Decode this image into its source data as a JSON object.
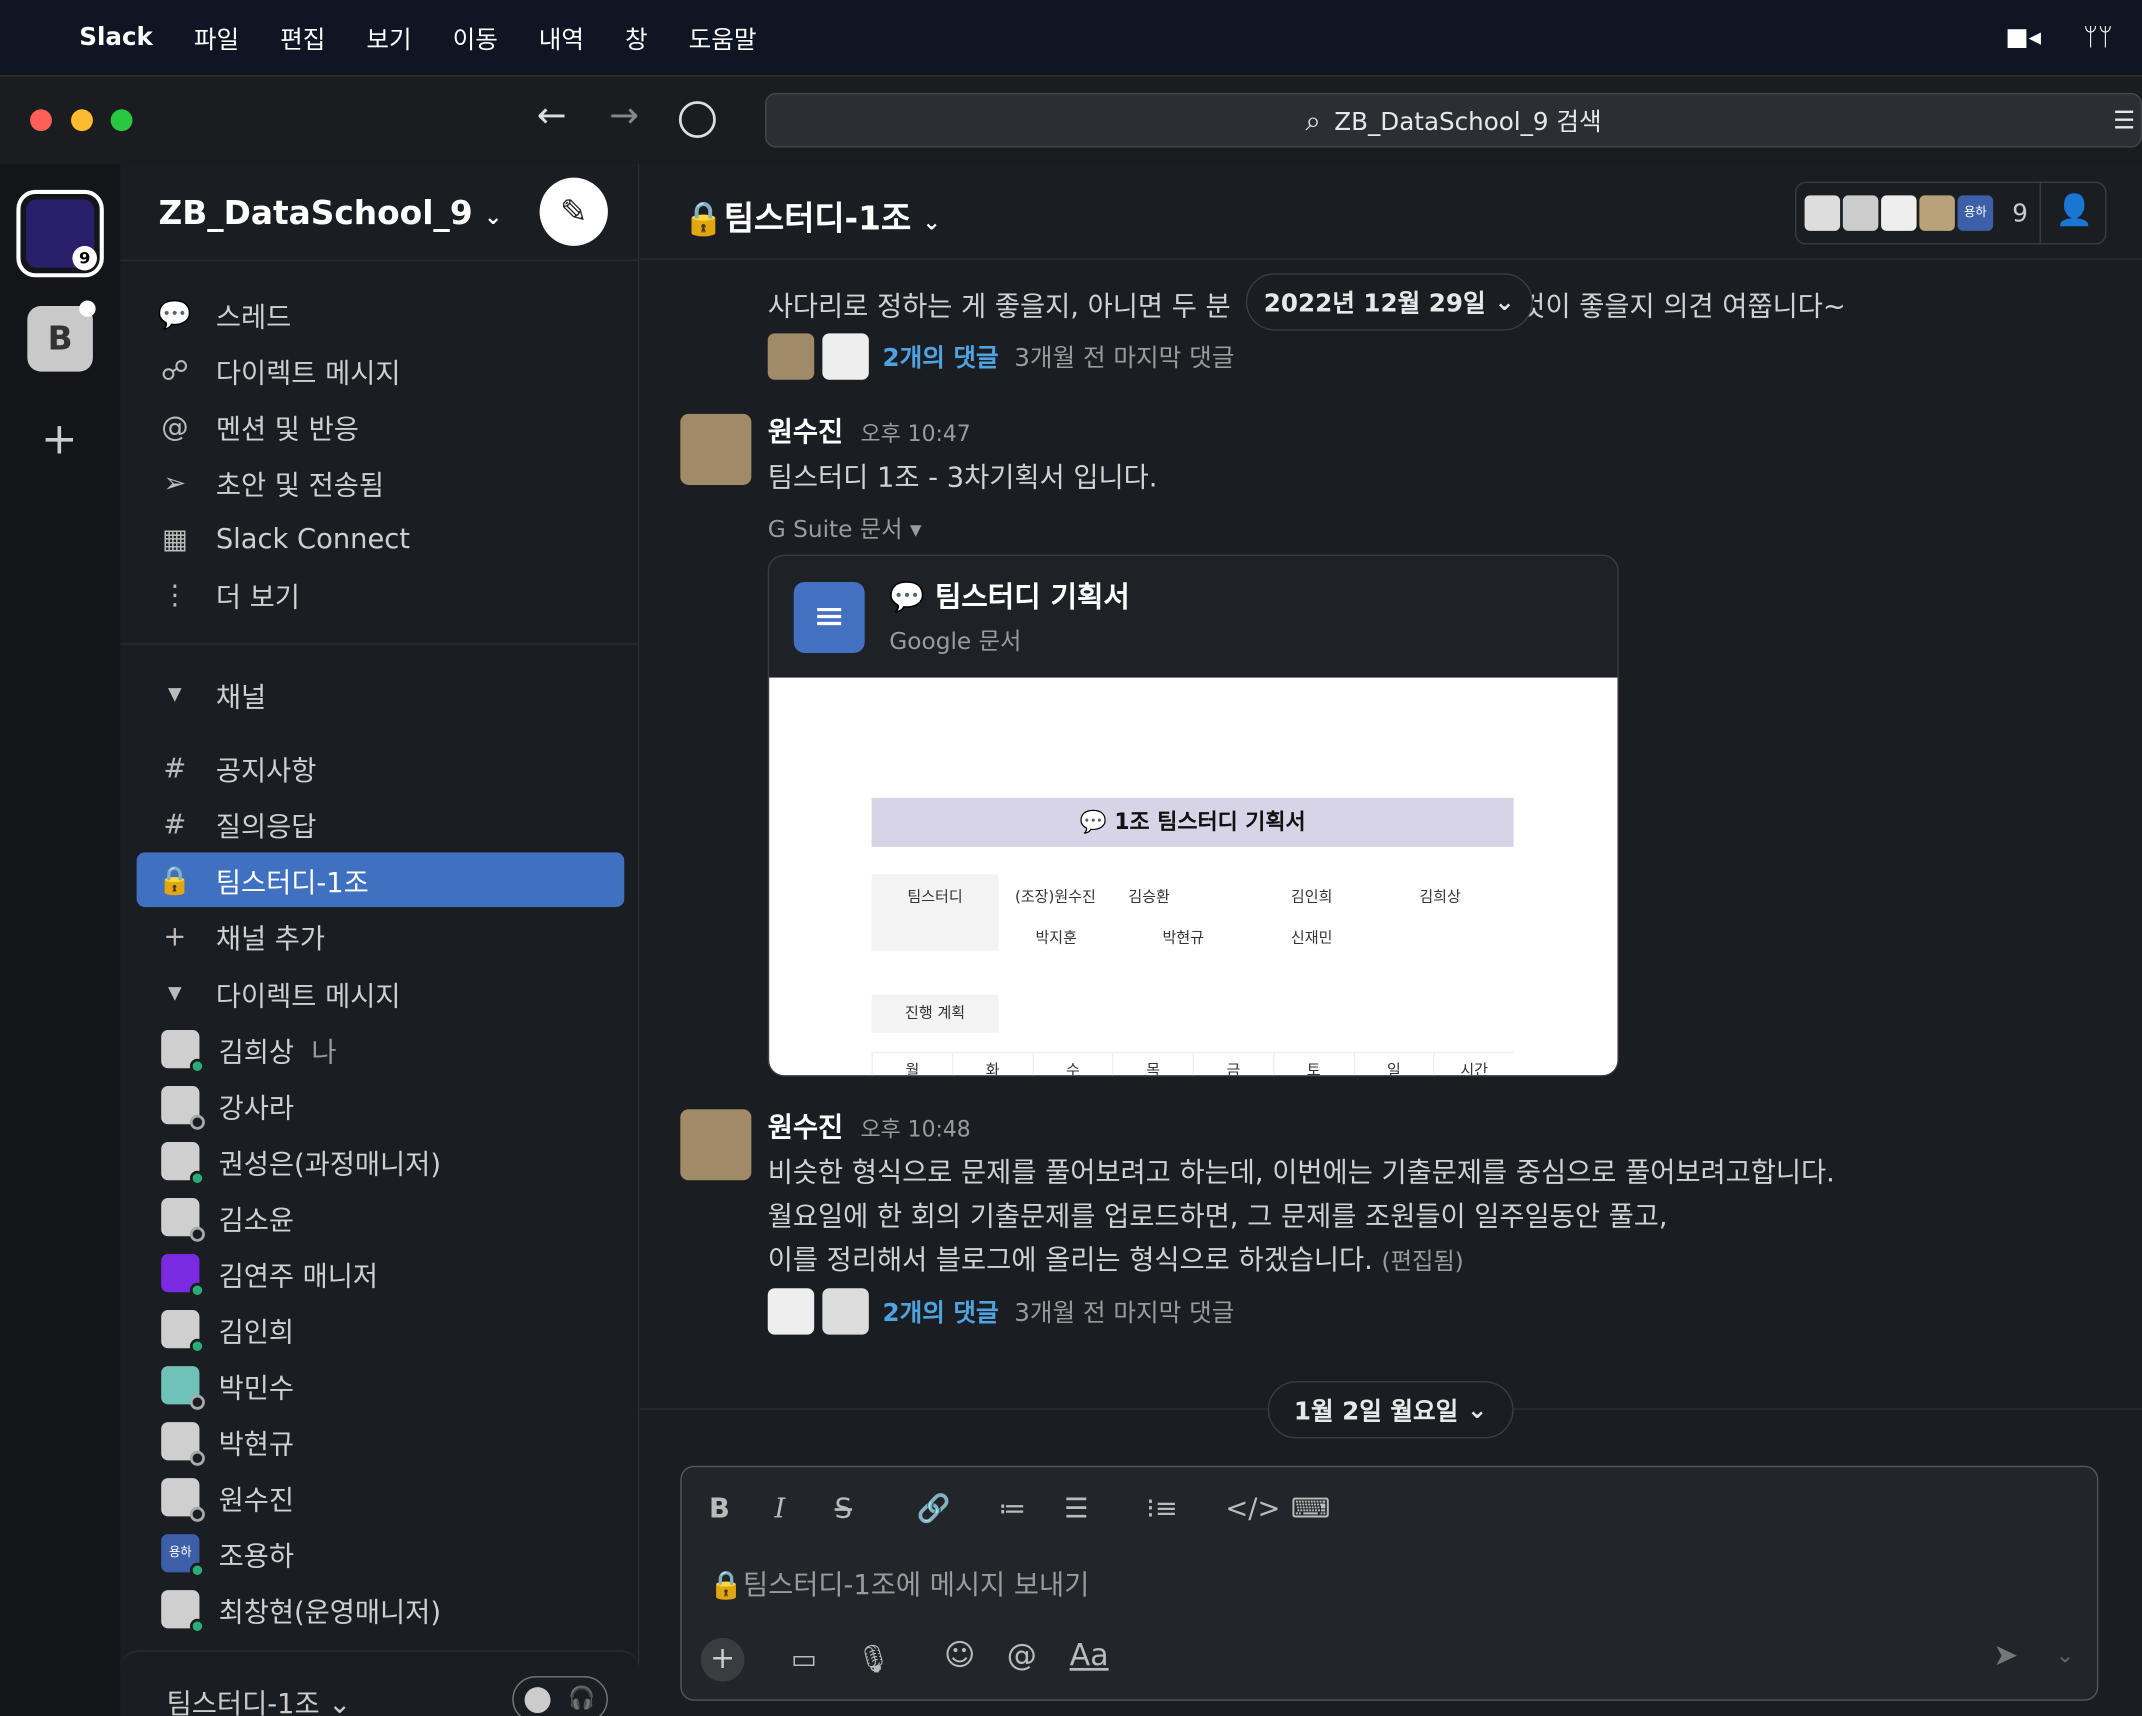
{
  "menubar": {
    "app": "Slack",
    "items": [
      "파일",
      "편집",
      "보기",
      "이동",
      "내역",
      "창",
      "도움말"
    ]
  },
  "titlebar": {
    "search": "ZB_DataSchool_9 검색"
  },
  "rail": {
    "workspace_badge": "9",
    "second_workspace": "B"
  },
  "sidebar": {
    "workspace": "ZB_DataSchool_9",
    "nav": [
      {
        "icon": "thread-icon",
        "glyph": "💬",
        "label": "스레드"
      },
      {
        "icon": "dm-icon",
        "glyph": "☍",
        "label": "다이렉트 메시지"
      },
      {
        "icon": "at-icon",
        "glyph": "@",
        "label": "멘션 및 반응"
      },
      {
        "icon": "send-icon",
        "glyph": "➢",
        "label": "초안 및 전송됨"
      },
      {
        "icon": "building-icon",
        "glyph": "▦",
        "label": "Slack Connect"
      },
      {
        "icon": "more-icon",
        "glyph": "⋮",
        "label": "더 보기"
      }
    ],
    "channels_header": "채널",
    "channels": [
      {
        "prefix": "#",
        "label": "공지사항"
      },
      {
        "prefix": "#",
        "label": "질의응답"
      },
      {
        "prefix": "🔒",
        "label": "팀스터디-1조",
        "selected": true
      },
      {
        "prefix": "+",
        "label": "채널 추가"
      }
    ],
    "dm_header": "다이렉트 메시지",
    "dms": [
      {
        "name": "김희상",
        "suffix": "나",
        "online": true
      },
      {
        "name": "강사라",
        "online": false
      },
      {
        "name": "권성은(과정매니저)",
        "online": true
      },
      {
        "name": "김소윤",
        "online": false
      },
      {
        "name": "김연주 매니저",
        "online": true,
        "color": "#7a2be2"
      },
      {
        "name": "김인희",
        "online": true
      },
      {
        "name": "박민수",
        "online": false,
        "color": "#6fc2b8"
      },
      {
        "name": "박현규",
        "online": false
      },
      {
        "name": "원수진",
        "online": false
      },
      {
        "name": "조용하",
        "online": true,
        "color": "#3d5fa8",
        "initials": "용하"
      },
      {
        "name": "최창현(운영매니저)",
        "online": true
      }
    ],
    "footer": "팀스터디-1조"
  },
  "channel": {
    "name": "팀스터디-1조",
    "member_count": "9",
    "avatar_initials": "용하"
  },
  "messages": {
    "prev_partial": "사다리로 정하는 게 좋을지, 아니면 두 분이 정하는 것이 좋을지 의견 여쭙니다~",
    "prev_left": "사다리로 정하는 게 좋을지, 아니면 두 분",
    "prev_right": "것이 좋을지 의견 여쭙니다~",
    "prev_replies": "2개의 댓글",
    "prev_replies_time": "3개월 전 마지막 댓글",
    "date_divider_1": "2022년 12월 29일",
    "m1": {
      "author": "원수진",
      "time": "오후 10:47",
      "text": "팀스터디 1조 - 3차기획서 입니다.",
      "attachment_label": "G Suite 문서",
      "doc_title": "💬 팀스터디 기획서",
      "doc_type": "Google 문서",
      "preview": {
        "title": "💬 1조 팀스터디 기획서",
        "row_label": "팀스터디",
        "members": [
          "(조장)원수진",
          "김승환",
          "김인희",
          "김희상",
          "박지훈",
          "박현규",
          "신재민"
        ],
        "plan_label": "진행 계획",
        "days": [
          "월",
          "화",
          "수",
          "목",
          "금",
          "토",
          "일",
          "시간"
        ]
      }
    },
    "m2": {
      "author": "원수진",
      "time": "오후 10:48",
      "lines": [
        "비슷한 형식으로 문제를 풀어보려고 하는데, 이번에는 기출문제를 중심으로 풀어보려고합니다.",
        "월요일에 한 회의 기출문제를 업로드하면, 그 문제를 조원들이 일주일동안 풀고,",
        "이를 정리해서 블로그에 올리는 형식으로 하겠습니다."
      ],
      "edited": "(편집됨)",
      "replies": "2개의 댓글",
      "replies_time": "3개월 전 마지막 댓글"
    },
    "date_divider_2": "1월 2일 월요일"
  },
  "composer": {
    "placeholder": "팀스터디-1조에 메시지 보내기",
    "format_aa": "Aa"
  },
  "colors": {
    "selected": "#4070c0",
    "link": "#4fa3e0",
    "online": "#2bac76"
  }
}
